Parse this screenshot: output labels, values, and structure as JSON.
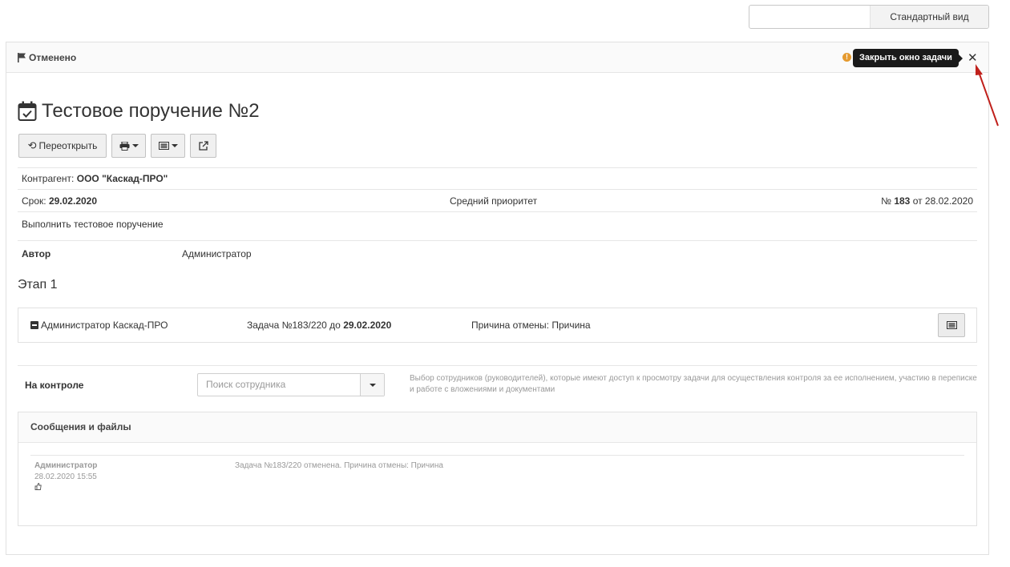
{
  "topbar": {
    "view_label": "Стандартный вид"
  },
  "header": {
    "status": "Отменено",
    "close_tooltip": "Закрыть окно задачи"
  },
  "task": {
    "title": "Тестовое поручение №2",
    "reopen_label": "Переоткрыть"
  },
  "info": {
    "counterparty_label": "Контрагент:",
    "counterparty_value": "ООО \"Каскад-ПРО\"",
    "deadline_label": "Срок:",
    "deadline_value": "29.02.2020",
    "priority": "Средний приоритет",
    "number_prefix": "№",
    "number_value": "183",
    "number_from": "от 28.02.2020",
    "description": "Выполнить тестовое поручение"
  },
  "author": {
    "label": "Автор",
    "value": "Администратор"
  },
  "stage": {
    "title": "Этап 1",
    "assignee": "Администратор Каскад-ПРО",
    "task_prefix": "Задача №183/220 до",
    "task_date": "29.02.2020",
    "reason": "Причина отмены: Причина"
  },
  "control": {
    "label": "На контроле",
    "search_placeholder": "Поиск сотрудника",
    "help": "Выбор сотрудников (руководителей), которые имеют доступ к просмотру задачи для осуществления контроля за ее исполнением, участию в переписке и работе с вложениями и документами"
  },
  "messages": {
    "title": "Сообщения и файлы",
    "items": [
      {
        "author": "Администратор",
        "time": "28.02.2020 15:55",
        "text": "Задача №183/220 отменена. Причина отмены: Причина"
      }
    ]
  },
  "colors": {
    "tooltip_bg": "#1a1a1a",
    "warning": "#e59a2f",
    "annotation_arrow": "#c0201b"
  }
}
